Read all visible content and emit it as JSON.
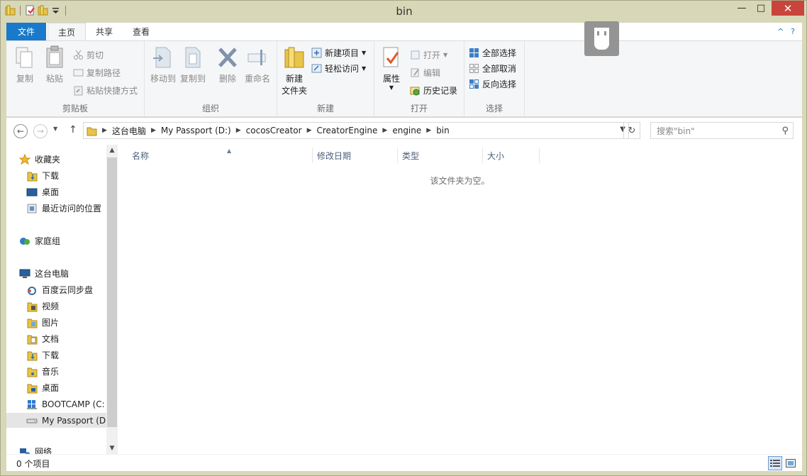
{
  "window": {
    "title": "bin",
    "minimize": "—",
    "maximize": "□",
    "close": "✕"
  },
  "ribbon_tabs": [
    {
      "label": "文件"
    },
    {
      "label": "主页"
    },
    {
      "label": "共享"
    },
    {
      "label": "查看"
    }
  ],
  "ribbon_right": {
    "collapse": "^",
    "help": "?"
  },
  "clipboard": {
    "copy": "复制",
    "paste": "粘贴",
    "cut": "剪切",
    "copy_path": "复制路径",
    "paste_shortcut": "粘贴快捷方式",
    "group": "剪贴板"
  },
  "organize": {
    "move_to": "移动到",
    "copy_to": "复制到",
    "delete": "删除",
    "rename": "重命名",
    "group": "组织"
  },
  "new": {
    "new_folder_line1": "新建",
    "new_folder_line2": "文件夹",
    "new_item": "新建项目",
    "easy_access": "轻松访问",
    "group": "新建"
  },
  "open": {
    "properties": "属性",
    "open": "打开",
    "edit": "编辑",
    "history": "历史记录",
    "group": "打开"
  },
  "select": {
    "select_all": "全部选择",
    "select_none": "全部取消",
    "invert": "反向选择",
    "group": "选择"
  },
  "address": {
    "crumbs": [
      "这台电脑",
      "My Passport (D:)",
      "cocosCreator",
      "CreatorEngine",
      "engine",
      "bin"
    ]
  },
  "search": {
    "placeholder": "搜索\"bin\""
  },
  "nav": {
    "favorites": "收藏夹",
    "downloads": "下载",
    "desktop": "桌面",
    "recent": "最近访问的位置",
    "homegroup": "家庭组",
    "this_pc": "这台电脑",
    "baidu": "百度云同步盘",
    "videos": "视频",
    "pictures": "图片",
    "documents": "文档",
    "downloads2": "下载",
    "music": "音乐",
    "desktop2": "桌面",
    "bootcamp": "BOOTCAMP (C:",
    "passport": "My Passport (D",
    "network": "网络"
  },
  "columns": {
    "name": "名称",
    "date": "修改日期",
    "type": "类型",
    "size": "大小"
  },
  "content": {
    "empty_message": "该文件夹为空。"
  },
  "status": {
    "count": "0 个项目"
  },
  "colors": {
    "accent": "#1979ca",
    "frame": "#d8d8b8",
    "close": "#c9443a"
  }
}
